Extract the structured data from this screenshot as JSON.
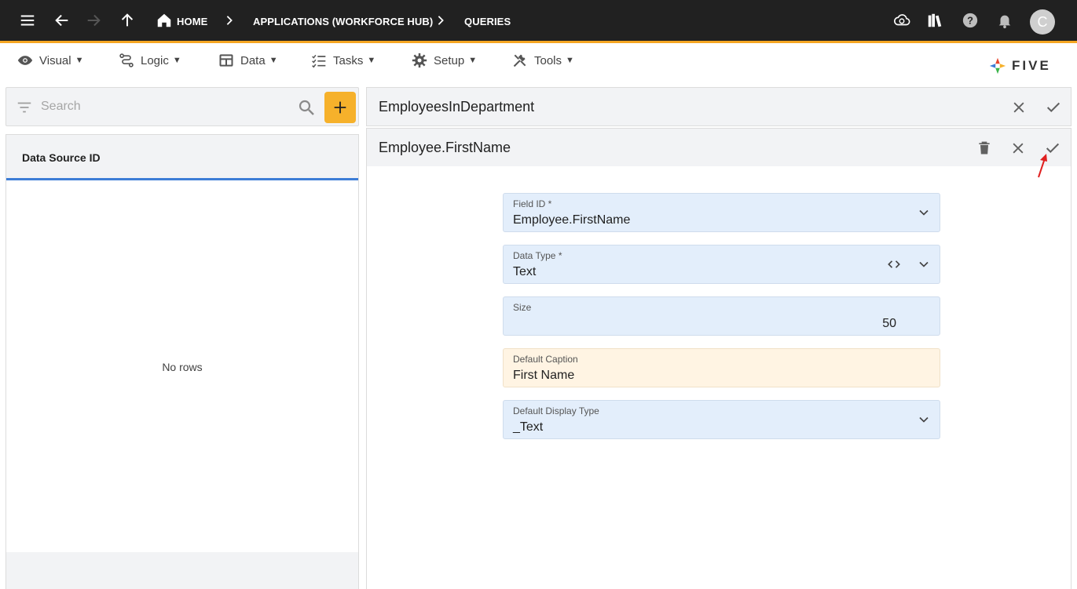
{
  "topbar": {
    "breadcrumbs": [
      "HOME",
      "APPLICATIONS (WORKFORCE HUB)",
      "QUERIES"
    ],
    "avatar_initial": "C"
  },
  "menu": {
    "items": [
      {
        "label": "Visual",
        "icon": "eye-icon"
      },
      {
        "label": "Logic",
        "icon": "logic-icon"
      },
      {
        "label": "Data",
        "icon": "table-icon"
      },
      {
        "label": "Tasks",
        "icon": "tasks-icon"
      },
      {
        "label": "Setup",
        "icon": "gear-icon"
      },
      {
        "label": "Tools",
        "icon": "tools-icon"
      }
    ],
    "caret": "▼",
    "logo_text": "FIVE"
  },
  "left": {
    "search_placeholder": "Search",
    "column_header": "Data Source ID",
    "empty_text": "No rows"
  },
  "query_panel": {
    "title": "EmployeesInDepartment"
  },
  "field_panel": {
    "title": "Employee.FirstName"
  },
  "form": {
    "field_id": {
      "label": "Field ID *",
      "value": "Employee.FirstName"
    },
    "data_type": {
      "label": "Data Type *",
      "value": "Text"
    },
    "size": {
      "label": "Size",
      "value": "50"
    },
    "default_caption": {
      "label": "Default Caption",
      "value": "First Name"
    },
    "default_display_type": {
      "label": "Default Display Type",
      "value": "_Text"
    }
  },
  "colors": {
    "topbar": "#212121",
    "accent": "#f5a623",
    "add_button": "#f6b12b",
    "field_bg": "#e3eefb",
    "caption_bg": "#fff4e3",
    "header_underline": "#3d7dd6",
    "annotation_arrow": "#e02020"
  }
}
